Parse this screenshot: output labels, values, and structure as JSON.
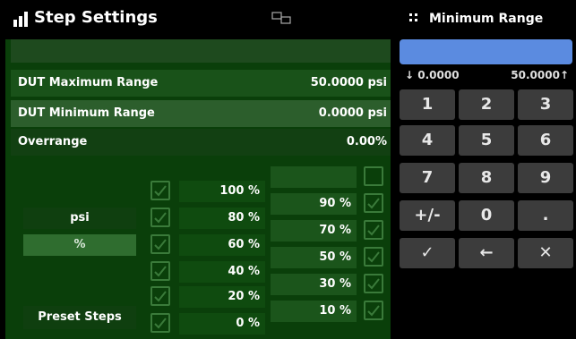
{
  "header": {
    "title": "Step Settings",
    "icon": "bar-chart-icon",
    "screen_icon": "screen-link-icon"
  },
  "keypad": {
    "title": "Minimum Range",
    "grid_icon": "keypad-grid-icon",
    "min_label": "↓ 0.0000",
    "max_label": "50.0000↑",
    "keys": [
      "1",
      "2",
      "3",
      "4",
      "5",
      "6",
      "7",
      "8",
      "9",
      "+/-",
      "0",
      ".",
      "✓",
      "←",
      "✕"
    ]
  },
  "settings": {
    "dut_max_label": "DUT Maximum Range",
    "dut_max_value": "50.0000 psi",
    "dut_min_label": "DUT Minimum Range",
    "dut_min_value": "0.0000 psi",
    "overrange_label": "Overrange",
    "overrange_value": "0.00%"
  },
  "units": {
    "psi": "psi",
    "percent": "%"
  },
  "preset_label": "Preset Steps",
  "steps_left": [
    "100 %",
    "80 %",
    "60 %",
    "40 %",
    "20 %",
    "0 %"
  ],
  "steps_right": [
    "",
    "90 %",
    "70 %",
    "50 %",
    "30 %",
    "10 %"
  ],
  "colors": {
    "accent": "#5b8be0",
    "panel": "#0a3f0a",
    "check": "#3a7a3a"
  }
}
